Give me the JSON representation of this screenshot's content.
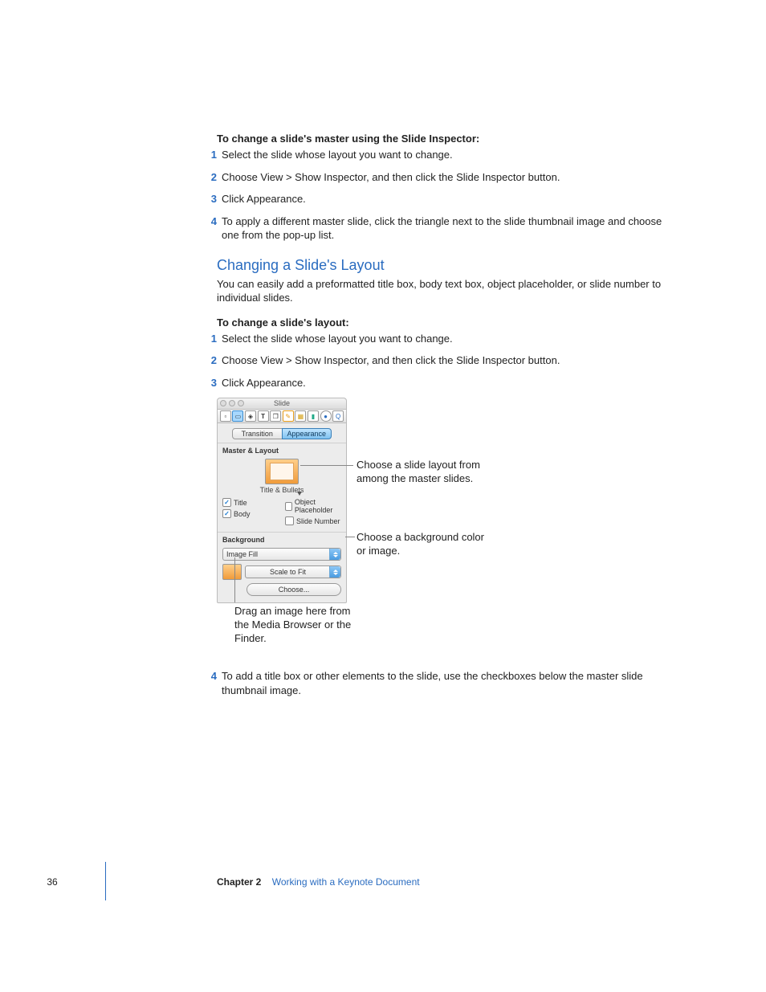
{
  "intro1_bold": "To change a slide's master using the Slide Inspector:",
  "list1": {
    "n1": "1",
    "t1": "Select the slide whose layout you want to change.",
    "n2": "2",
    "t2": "Choose View > Show Inspector, and then click the Slide Inspector button.",
    "n3": "3",
    "t3": "Click Appearance.",
    "n4": "4",
    "t4": "To apply a different master slide, click the triangle next to the slide thumbnail image and choose one from the pop-up list."
  },
  "heading2": "Changing a Slide's Layout",
  "para2": "You can easily add a preformatted title box, body text box, object placeholder, or slide number to individual slides.",
  "intro2_bold": "To change a slide's layout:",
  "list2": {
    "n1": "1",
    "t1": "Select the slide whose layout you want to change.",
    "n2": "2",
    "t2": "Choose View > Show Inspector, and then click the Slide Inspector button.",
    "n3": "3",
    "t3": "Click Appearance."
  },
  "list2b": {
    "n4": "4",
    "t4": "To add a title box or other elements to the slide, use the checkboxes below the master slide thumbnail image."
  },
  "inspector": {
    "title": "Slide",
    "tab_transition": "Transition",
    "tab_appearance": "Appearance",
    "sec_master": "Master & Layout",
    "thumb_label": "Title & Bullets",
    "ck_title": "Title",
    "ck_body": "Body",
    "ck_obj": "Object Placeholder",
    "ck_num": "Slide Number",
    "sec_bg": "Background",
    "dd_fill": "Image Fill",
    "dd_scale": "Scale to Fit",
    "btn_choose": "Choose...",
    "icons": {
      "doc": "document-icon",
      "slide": "slide-icon",
      "build": "build-icon",
      "text": "text-icon",
      "graphic": "graphic-icon",
      "metrics": "metrics-icon",
      "table": "table-icon",
      "chart": "chart-icon",
      "link": "hyperlink-icon",
      "qt": "quicktime-icon"
    }
  },
  "callout1": "Choose a slide layout from among the master slides.",
  "callout2": "Choose a background color or image.",
  "callout3": "Drag an image here from the Media Browser or the Finder.",
  "footer": {
    "page": "36",
    "chapter_label": "Chapter 2",
    "chapter_title": "Working with a Keynote Document"
  }
}
